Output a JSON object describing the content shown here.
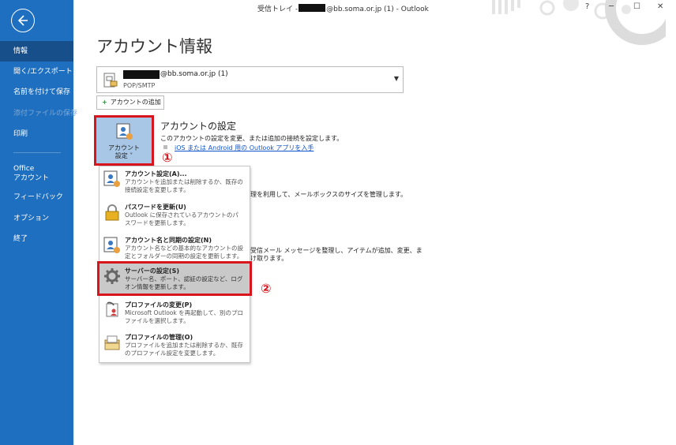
{
  "window": {
    "title_prefix": "受信トレイ -",
    "title_suffix": "@bb.soma.or.jp (1)  -  Outlook",
    "help": "?",
    "minimize": "─",
    "maximize": "☐",
    "close": "✕"
  },
  "sidebar": {
    "items": [
      {
        "label": "情報"
      },
      {
        "label": "開く/エクスポート"
      },
      {
        "label": "名前を付けて保存"
      },
      {
        "label": "添付ファイルの保存"
      },
      {
        "label": "印刷"
      },
      {
        "label": "Office"
      },
      {
        "label": "アカウント"
      },
      {
        "label": "フィードバック"
      },
      {
        "label": "オプション"
      },
      {
        "label": "終了"
      }
    ]
  },
  "main": {
    "title": "アカウント情報",
    "account": {
      "email": "@bb.soma.or.jp (1)",
      "type": "POP/SMTP"
    },
    "add_account": "アカウントの追加",
    "settings_button": {
      "line1": "アカウント",
      "line2": "設定 ˅"
    },
    "section": {
      "title": "アカウントの設定",
      "desc": "このアカウントの設定を変更、または追加の接続を設定します。",
      "link": "iOS または Android 用の Outlook アプリを入手"
    },
    "background_texts": [
      "理を利用して、メールボックスのサイズを管理します。",
      "受信メール メッセージを整理し、アイテムが追加、変更、ま",
      "け取ります。"
    ]
  },
  "markers": {
    "one": "①",
    "two": "②"
  },
  "dropdown": {
    "items": [
      {
        "title": "アカウント設定(A)...",
        "desc": "アカウントを追加または削除するか、既存の接続設定を変更します。"
      },
      {
        "title": "パスワードを更新(U)",
        "desc": "Outlook に保存されているアカウントのパスワードを更新します。"
      },
      {
        "title": "アカウント名と同期の設定(N)",
        "desc": "アカウント名などの基本的なアカウントの設定とフォルダーの同期の設定を更新します。"
      },
      {
        "title": "サーバーの設定(S)",
        "desc": "サーバー名、ポート、認証の設定など、ログオン情報を更新します。"
      },
      {
        "title": "プロファイルの変更(P)",
        "desc": "Microsoft Outlook を再起動して、別のプロファイルを選択します。"
      },
      {
        "title": "プロファイルの管理(O)",
        "desc": "プロファイルを追加または削除するか、既存のプロファイル設定を変更します。"
      }
    ]
  },
  "colors": {
    "sidebar": "#1e6fbf",
    "sidebar_active": "#174f8a",
    "highlight_border": "#d8141c"
  }
}
